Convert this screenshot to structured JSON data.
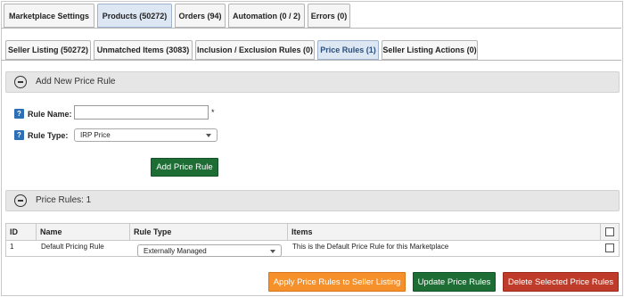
{
  "top_tabs": [
    {
      "label": "Marketplace Settings",
      "active": false
    },
    {
      "label": "Products (50272)",
      "active": true
    },
    {
      "label": "Orders (94)",
      "active": false
    },
    {
      "label": "Automation (0 / 2)",
      "active": false
    },
    {
      "label": "Errors (0)",
      "active": false
    }
  ],
  "sub_tabs": [
    {
      "label": "Seller Listing (50272)",
      "active": false
    },
    {
      "label": "Unmatched Items (3083)",
      "active": false
    },
    {
      "label": "Inclusion / Exclusion Rules (0)",
      "active": false
    },
    {
      "label": "Price Rules (1)",
      "active": true
    },
    {
      "label": "Seller Listing Actions (0)",
      "active": false
    }
  ],
  "add_section": {
    "title": "Add New Price Rule",
    "rule_name_label": "Rule Name:",
    "rule_name_value": "",
    "required_mark": "*",
    "rule_type_label": "Rule Type:",
    "rule_type_value": "IRP Price",
    "add_button": "Add Price Rule",
    "help_icon_glyph": "?"
  },
  "list_section": {
    "title": "Price Rules: 1",
    "columns": [
      "ID",
      "Name",
      "Rule Type",
      "Items"
    ],
    "rows": [
      {
        "id": "1",
        "name": "Default Pricing Rule",
        "rule_type": "Externally Managed",
        "items": "This is the Default Price Rule for this Marketplace",
        "checked": false
      }
    ]
  },
  "actions": {
    "apply": "Apply Price Rules to Seller Listing",
    "update": "Update Price Rules",
    "delete": "Delete Selected Price Rules"
  },
  "colors": {
    "green_button": "#1d6d35",
    "orange_button": "#f5902a",
    "red_button": "#bf3b2a",
    "help_icon": "#2d6fb7",
    "active_tab": "#dde7f3"
  }
}
